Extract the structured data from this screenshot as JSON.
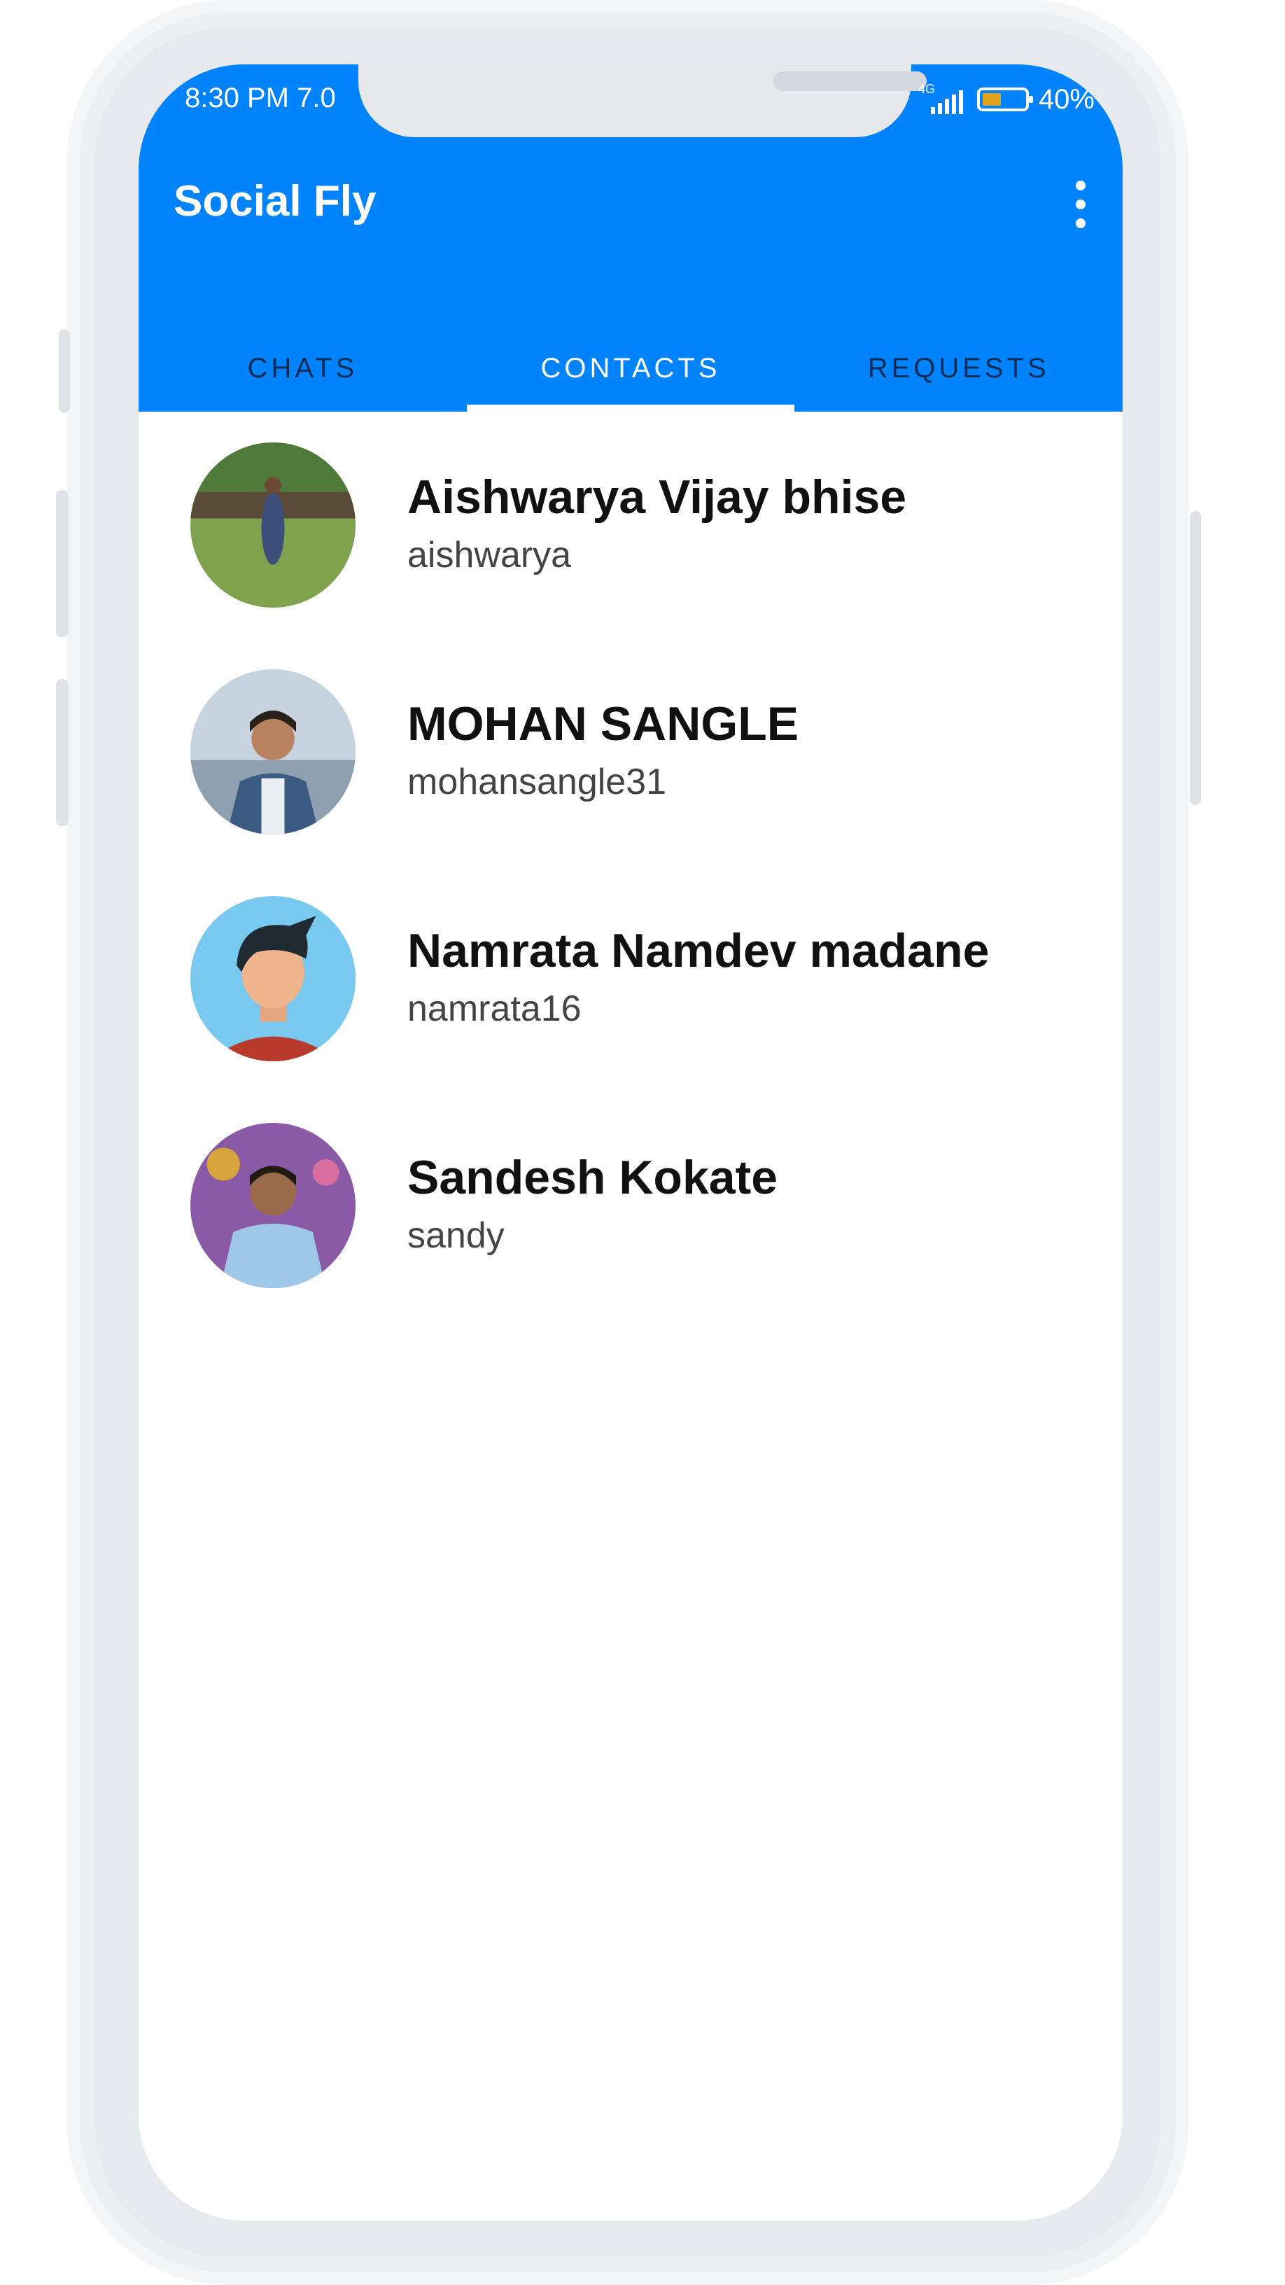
{
  "status_bar": {
    "time": "8:30 PM  7.0",
    "network": "4G",
    "battery": "40%"
  },
  "app": {
    "title": "Social Fly",
    "menu_icon": "more-vert-icon"
  },
  "tabs": [
    {
      "label": "CHATS",
      "active": false
    },
    {
      "label": "CONTACTS",
      "active": true
    },
    {
      "label": "REQUESTS",
      "active": false
    }
  ],
  "contacts": [
    {
      "name": "Aishwarya Vijay bhise",
      "username": "aishwarya"
    },
    {
      "name": "MOHAN SANGLE",
      "username": "mohansangle31"
    },
    {
      "name": "Namrata Namdev madane",
      "username": "namrata16"
    },
    {
      "name": "Sandesh Kokate",
      "username": "sandy"
    }
  ],
  "colors": {
    "primary": "#0083fc",
    "inactive_tab": "#0a2d57",
    "text_primary": "#111111",
    "text_secondary": "#444444"
  }
}
